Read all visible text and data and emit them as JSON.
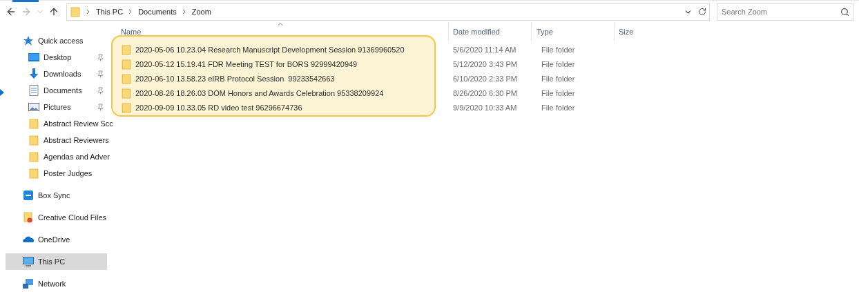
{
  "address_bar": {
    "path": [
      "This PC",
      "Documents",
      "Zoom"
    ]
  },
  "search": {
    "placeholder": "Search Zoom"
  },
  "sidebar": {
    "items": [
      {
        "label": "Quick access",
        "kind": "star",
        "selected": false,
        "children": [
          {
            "label": "Desktop",
            "kind": "desktop",
            "pinned": true,
            "selected": false
          },
          {
            "label": "Downloads",
            "kind": "download",
            "pinned": true,
            "selected": false
          },
          {
            "label": "Documents",
            "kind": "document",
            "pinned": true,
            "selected": false
          },
          {
            "label": "Pictures",
            "kind": "pictures",
            "pinned": true,
            "selected": false
          },
          {
            "label": "Abstract Review Scc",
            "kind": "folder",
            "pinned": false,
            "selected": false
          },
          {
            "label": "Abstract Reviewers",
            "kind": "folder",
            "pinned": false,
            "selected": false
          },
          {
            "label": "Agendas and Adver",
            "kind": "folder",
            "pinned": false,
            "selected": false
          },
          {
            "label": "Poster Judges",
            "kind": "folder",
            "pinned": false,
            "selected": false
          }
        ]
      },
      {
        "label": "Box Sync",
        "kind": "box",
        "selected": false
      },
      {
        "label": "Creative Cloud Files",
        "kind": "cloud-folder",
        "selected": false
      },
      {
        "label": "OneDrive",
        "kind": "onedrive",
        "selected": false
      },
      {
        "label": "This PC",
        "kind": "pc",
        "selected": true
      },
      {
        "label": "Network",
        "kind": "network",
        "selected": false
      }
    ]
  },
  "table": {
    "columns": [
      "Name",
      "Date modified",
      "Type",
      "Size"
    ],
    "highlighted": true,
    "rows": [
      {
        "name": "2020-05-06 10.23.04 Research Manuscript Development Session 91369960520",
        "date": "5/6/2020 11:14 AM",
        "type": "File folder"
      },
      {
        "name": "2020-05-12 15.19.41 FDR Meeting TEST for BORS 92999420949",
        "date": "5/12/2020 3:43 PM",
        "type": "File folder"
      },
      {
        "name": "2020-06-10 13.58.23 eIRB Protocol Session  99233542663",
        "date": "6/10/2020 2:33 PM",
        "type": "File folder"
      },
      {
        "name": "2020-08-26 18.26.03 DOM Honors and Awards Celebration 95338209924",
        "date": "8/26/2020 6:30 PM",
        "type": "File folder"
      },
      {
        "name": "2020-09-09 10.33.05 RD video test 96296674736",
        "date": "9/9/2020 10:33 AM",
        "type": "File folder"
      }
    ]
  }
}
